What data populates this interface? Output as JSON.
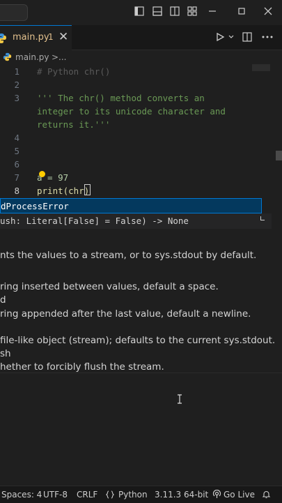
{
  "editor_tab": {
    "filename": "main.py",
    "problem_count": "1",
    "close_glyph": "✕"
  },
  "breadcrumb": {
    "file": "main.py",
    "separator": ">",
    "more": "..."
  },
  "lines": [
    {
      "num": "1",
      "text": "# Python chr()"
    },
    {
      "num": "2",
      "text": ""
    },
    {
      "num": "3",
      "text": "''' The chr() method converts an"
    },
    {
      "num": "",
      "text": "integer to its unicode character and"
    },
    {
      "num": "",
      "text": "returns it.'''"
    },
    {
      "num": "4",
      "text": ""
    },
    {
      "num": "5",
      "text": ""
    },
    {
      "num": "6",
      "text": ""
    },
    {
      "num": "7",
      "text": "a = 97"
    },
    {
      "num": "8",
      "text": "print(chr)"
    }
  ],
  "suggestion": {
    "label": "dProcessError"
  },
  "signature": {
    "text": "ush: Literal[False] = False) -> None"
  },
  "docs": [
    "nts the values to a stream, or to sys.stdout by default.",
    "",
    "ring inserted between values, default a space.",
    "d",
    "ring appended after the last value, default a newline.",
    "",
    "file-like object (stream); defaults to the current sys.stdout.",
    "sh",
    "hether to forcibly flush the stream."
  ],
  "statusbar": {
    "spaces": "Spaces: 4",
    "encoding": "UTF-8",
    "eol": "CRLF",
    "language": "Python",
    "interpreter": "3.11.3 64-bit",
    "golive": "Go Live"
  },
  "colors": {
    "accent": "#0078d4",
    "suggest_bg": "#04395e",
    "comment": "#6a9955",
    "string": "#b5cea8"
  },
  "icons": [
    "layout-sidebar-icon",
    "layout-panel-icon",
    "layout-secondary-icon",
    "customize-layout-icon",
    "minimize-icon",
    "restore-icon",
    "close-icon",
    "run-icon",
    "split-editor-icon",
    "more-icon",
    "bell-icon",
    "broadcast-icon",
    "python-file-icon",
    "lightbulb-icon"
  ]
}
